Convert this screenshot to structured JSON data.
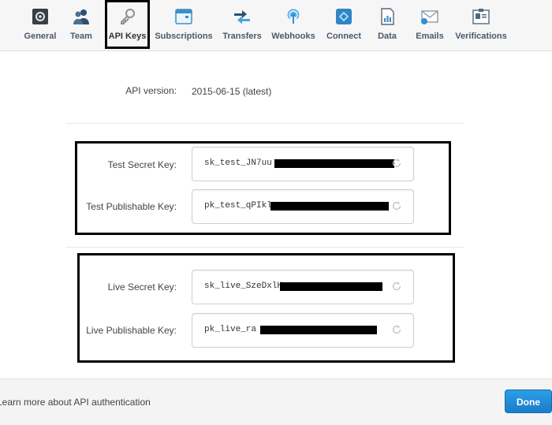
{
  "tabs": [
    {
      "id": "general",
      "label": "General"
    },
    {
      "id": "team",
      "label": "Team"
    },
    {
      "id": "api-keys",
      "label": "API Keys",
      "active": true
    },
    {
      "id": "subscriptions",
      "label": "Subscriptions"
    },
    {
      "id": "transfers",
      "label": "Transfers"
    },
    {
      "id": "webhooks",
      "label": "Webhooks"
    },
    {
      "id": "connect",
      "label": "Connect"
    },
    {
      "id": "data",
      "label": "Data"
    },
    {
      "id": "emails",
      "label": "Emails"
    },
    {
      "id": "verifications",
      "label": "Verifications"
    }
  ],
  "api_version": {
    "label": "API version:",
    "value": "2015-06-15 (latest)"
  },
  "test_keys": {
    "secret_label": "Test Secret Key:",
    "secret_value": "sk_test_JN7uu",
    "publishable_label": "Test Publishable Key:",
    "publishable_value": "pk_test_qPIkl"
  },
  "live_keys": {
    "secret_label": "Live Secret Key:",
    "secret_value": "sk_live_SzeDxlH",
    "publishable_label": "Live Publishable Key:",
    "publishable_value": "pk_live_ra"
  },
  "footer": {
    "learn_more": "Learn more about API authentication",
    "done_label": "Done"
  },
  "colors": {
    "accent": "#1a7cc9",
    "tab_label": "#4a5a6a"
  }
}
